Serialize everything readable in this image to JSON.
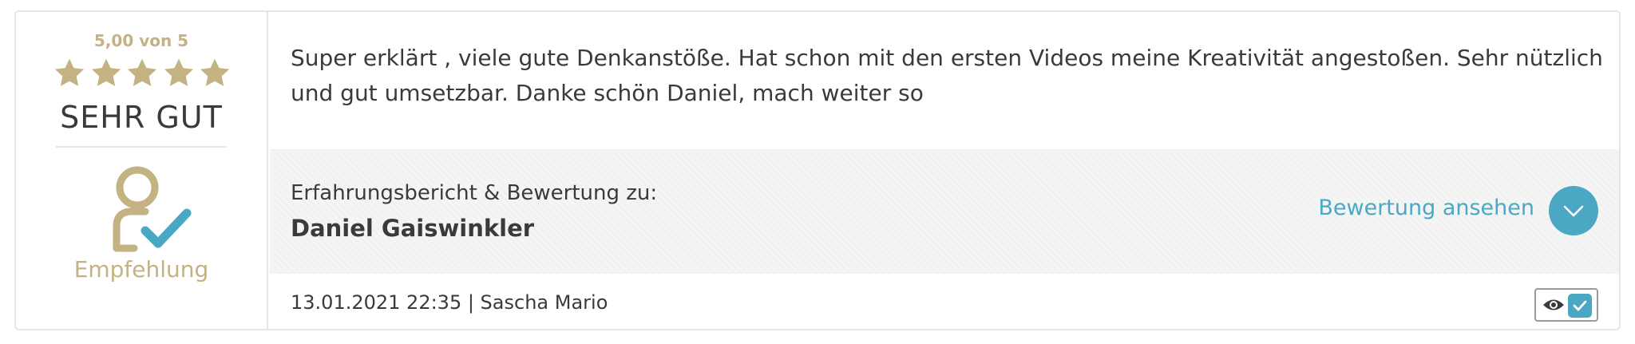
{
  "rating": {
    "score_text": "5,00 von 5",
    "stars_filled": 5,
    "stars_total": 5,
    "label": "SEHR GUT",
    "recommendation_label": "Empfehlung",
    "accent_color": "#c4b283"
  },
  "review": {
    "text": "Super erklärt , viele gute Denkanstöße. Hat schon mit den ersten Videos meine Kreativität angestoßen. Sehr nützlich und gut umsetzbar. Danke schön Daniel, mach weiter so"
  },
  "subject": {
    "label": "Erfahrungsbericht & Bewertung zu:",
    "name": "Daniel Gaiswinkler",
    "view_link": "Bewertung ansehen",
    "link_color": "#4aa8c4"
  },
  "meta": {
    "text": "13.01.2021 22:35 | Sascha Mario"
  },
  "icons": [
    "star-icon",
    "person-check-icon",
    "chevron-down-icon",
    "eye-icon",
    "check-icon"
  ]
}
